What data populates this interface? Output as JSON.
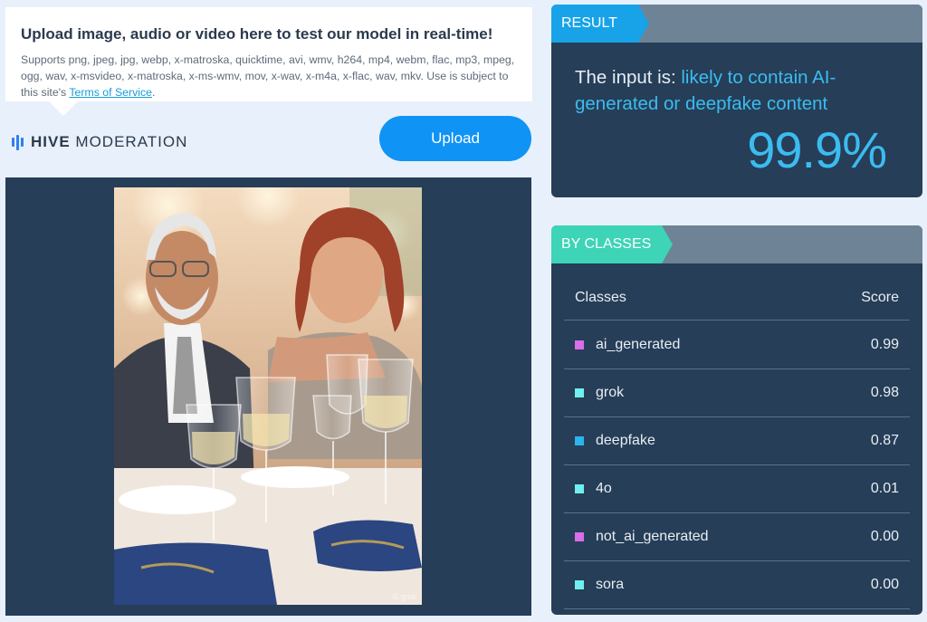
{
  "upload": {
    "title": "Upload image, audio or video here to test our model in real-time!",
    "formats": "Supports png, jpeg, jpg, webp, x-matroska, quicktime, avi, wmv, h264, mp4, webm, flac, mp3, mpeg, ogg, wav, x-msvideo, x-matroska, x-ms-wmv, mov, x-wav, x-m4a, x-flac, wav, mkv. Use is subject to this site's ",
    "terms_link": "Terms of Service",
    "terms_suffix": ".",
    "button_label": "Upload"
  },
  "brand": {
    "bold": "HIVE",
    "light": "MODERATION",
    "icon": "hive-logo-icon"
  },
  "image": {
    "watermark": "© grok"
  },
  "result": {
    "tag": "RESULT",
    "prefix": "The input is: ",
    "verdict": "likely to contain AI-generated or deepfake content",
    "score": "99.9%"
  },
  "classes": {
    "tag": "BY CLASSES",
    "header_class": "Classes",
    "header_score": "Score",
    "rows": [
      {
        "name": "ai_generated",
        "score": "0.99",
        "color": "#d86ee8"
      },
      {
        "name": "grok",
        "score": "0.98",
        "color": "#6ff0ee"
      },
      {
        "name": "deepfake",
        "score": "0.87",
        "color": "#2ab5f0"
      },
      {
        "name": "4o",
        "score": "0.01",
        "color": "#6ff0ee"
      },
      {
        "name": "not_ai_generated",
        "score": "0.00",
        "color": "#d86ee8"
      },
      {
        "name": "sora",
        "score": "0.00",
        "color": "#6ff0ee"
      }
    ]
  },
  "colors": {
    "accent_blue": "#0f93f5",
    "panel_bg": "#263e57",
    "result_tag": "#18a3e8",
    "classes_tag": "#3dd4b7",
    "highlight": "#3bbcf0"
  }
}
